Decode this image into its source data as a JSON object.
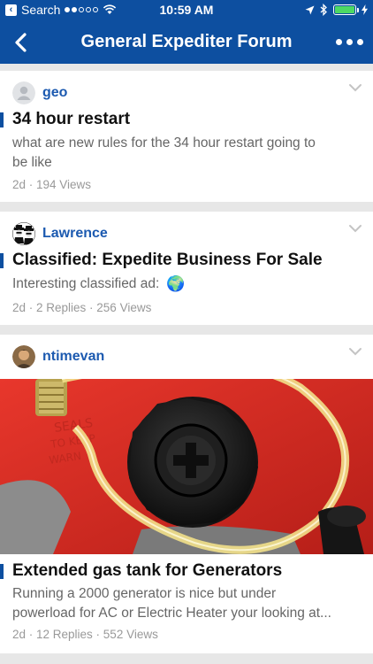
{
  "status_bar": {
    "back_label": "Search",
    "time": "10:59 AM",
    "signal_dots_filled": 2,
    "signal_dots_total": 5,
    "battery_level": 1.0,
    "icons": [
      "wifi-icon",
      "location-arrow-icon",
      "bluetooth-icon",
      "charging-bolt-icon"
    ]
  },
  "nav": {
    "title": "General Expediter Forum",
    "back_icon": "chevron-left-icon",
    "more_icon": "more-horizontal-icon"
  },
  "posts": [
    {
      "author": "geo",
      "avatar": "default-user-avatar",
      "title": "34 hour restart",
      "excerpt_lines": [
        "what are new rules for the 34 hour restart going to",
        "be like"
      ],
      "meta": "2d · 194 Views"
    },
    {
      "author": "Lawrence",
      "avatar": "blues-brothers-avatar",
      "title": "Classified: Expedite Business For Sale",
      "excerpt_lines": [
        "Interesting classified ad:"
      ],
      "excerpt_emoji": "🌍",
      "meta": "2d · 2 Replies · 256 Views"
    },
    {
      "author": "ntimevan",
      "avatar": "photo-avatar",
      "image": "gas-tank-cap-photo",
      "title": "Extended gas tank for Generators",
      "excerpt_lines": [
        "Running a 2000 generator is nice but under",
        "powerload for AC or Electric Heater  your looking at..."
      ],
      "meta": "2d · 12 Replies · 552 Views"
    }
  ],
  "colors": {
    "brand_blue": "#0d4fa0",
    "username_blue": "#1c5ab0",
    "background_gray": "#e7e7e7"
  }
}
